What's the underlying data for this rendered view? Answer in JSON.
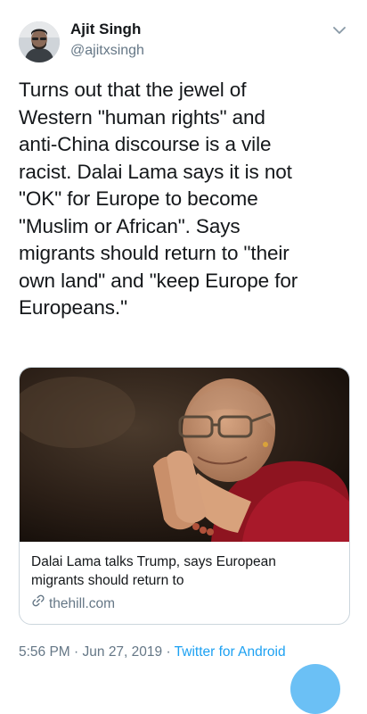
{
  "author": {
    "display_name": "Ajit Singh",
    "handle": "@ajitxsingh"
  },
  "tweet": {
    "text": "Turns out that the jewel of\nWestern \"human rights\" and\nanti-China discourse is a vile\nracist. Dalai Lama says it is not\n\"OK\" for Europe to become\n\"Muslim or African\". Says\nmigrants should return to \"their\nown land\" and \"keep Europe for\nEuropeans.\""
  },
  "link_card": {
    "title": "Dalai Lama talks Trump, says European\nmigrants should return to",
    "domain": "thehill.com",
    "domain_icon": "link-icon"
  },
  "meta": {
    "time": "5:56 PM",
    "separator1": " · ",
    "date": "Jun 27, 2019",
    "separator2": " · ",
    "source": "Twitter for Android"
  },
  "icons": {
    "menu": "chevron-down-icon",
    "compose": "compose-fab"
  },
  "colors": {
    "text": "#14171a",
    "secondary": "#657786",
    "accent": "#1da1f2",
    "border": "#ccd6dd"
  }
}
